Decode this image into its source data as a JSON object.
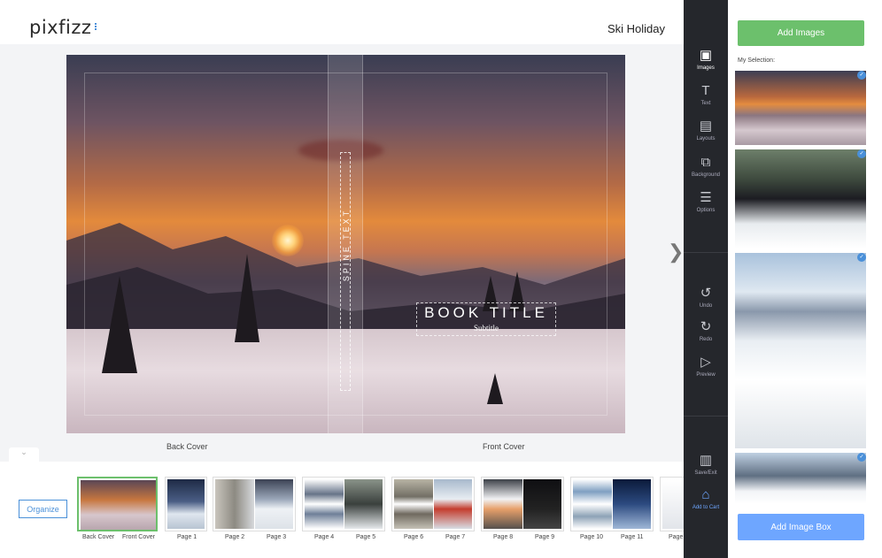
{
  "header": {
    "logo": "pixfizz",
    "project_title": "Ski Holiday"
  },
  "canvas": {
    "spine_text": "SPINE TEXT",
    "book_title": "BOOK TITLE",
    "subtitle": "Subtitle",
    "back_cover_label": "Back Cover",
    "front_cover_label": "Front Cover",
    "next_icon": "chevron-right-icon"
  },
  "filmstrip": {
    "organize_label": "Organize",
    "labels": {
      "back_cover": "Back Cover",
      "front_cover": "Front Cover",
      "p1": "Page 1",
      "p2": "Page 2",
      "p3": "Page 3",
      "p4": "Page 4",
      "p5": "Page 5",
      "p6": "Page 6",
      "p7": "Page 7",
      "p8": "Page 8",
      "p9": "Page 9",
      "p10": "Page 10",
      "p11": "Page 11",
      "p12": "Page"
    }
  },
  "toolbar": {
    "images": "Images",
    "text": "Text",
    "layouts": "Layouts",
    "background": "Background",
    "options": "Options",
    "undo": "Undo",
    "redo": "Redo",
    "preview": "Preview",
    "save_exit": "Save/Exit",
    "add_to_cart": "Add to Cart"
  },
  "panel": {
    "add_images_label": "Add Images",
    "selection_label": "My Selection:",
    "add_image_box_label": "Add Image Box"
  },
  "colors": {
    "green": "#6cc06c",
    "blue": "#6ea6ff",
    "toolbar_bg": "#25272c"
  }
}
